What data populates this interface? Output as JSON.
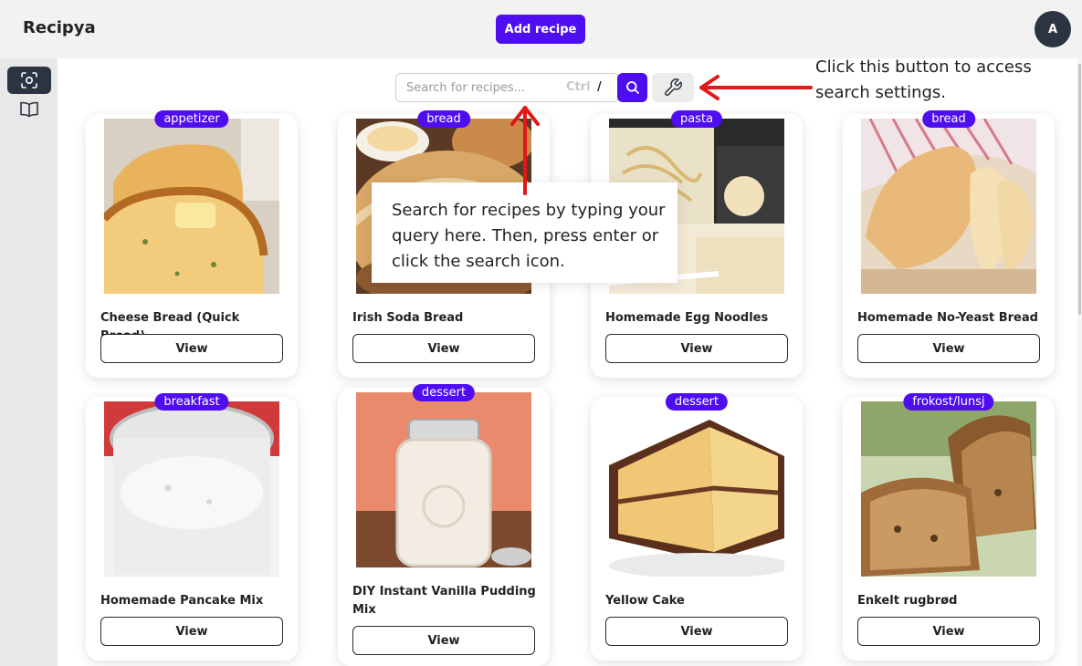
{
  "header": {
    "brand": "Recipya",
    "add_recipe_label": "Add recipe",
    "avatar_initial": "A"
  },
  "sidebar": {
    "items": [
      {
        "icon": "scan-icon",
        "active": true
      },
      {
        "icon": "book-icon",
        "active": false
      }
    ]
  },
  "search": {
    "placeholder": "Search for recipes...",
    "shortcut_ctrl": "Ctrl",
    "shortcut_key": "/",
    "search_icon": "search-icon",
    "settings_icon": "wrench-icon"
  },
  "tooltips": {
    "settings": "Click this button to access search settings.",
    "search": "Search for recipes by typing your query here. Then, press enter or click the search icon."
  },
  "recipes": [
    {
      "tag": "appetizer",
      "title": "Cheese Bread (Quick Bread)",
      "view_label": "View"
    },
    {
      "tag": "bread",
      "title": "Irish Soda Bread",
      "view_label": "View"
    },
    {
      "tag": "pasta",
      "title": "Homemade Egg Noodles",
      "view_label": "View"
    },
    {
      "tag": "bread",
      "title": "Homemade No-Yeast Bread",
      "view_label": "View"
    },
    {
      "tag": "breakfast",
      "title": "Homemade Pancake Mix",
      "view_label": "View"
    },
    {
      "tag": "dessert",
      "title": "DIY Instant Vanilla Pudding Mix",
      "view_label": "View"
    },
    {
      "tag": "dessert",
      "title": "Yellow Cake",
      "view_label": "View"
    },
    {
      "tag": "frokost/lunsj",
      "title": "Enkelt rugbrød",
      "view_label": "View"
    }
  ],
  "colors": {
    "accent": "#4f0ef0",
    "dark": "#2b3440",
    "annotation_arrow": "#e01818"
  }
}
